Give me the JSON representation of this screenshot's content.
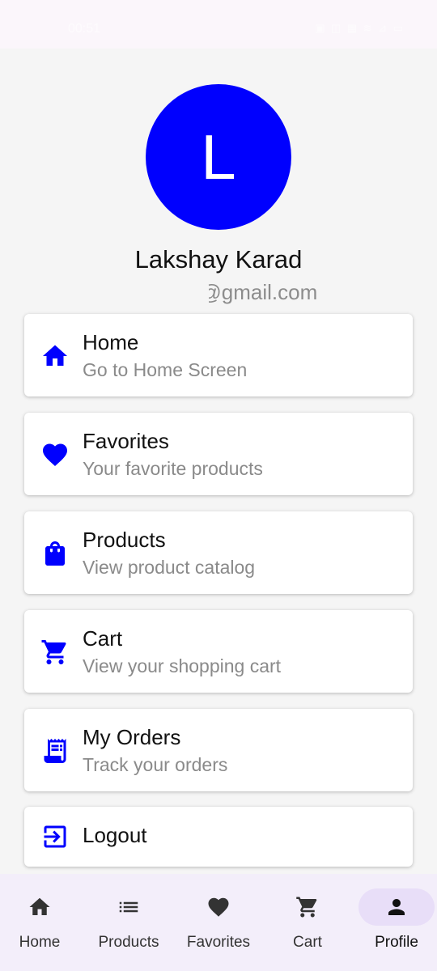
{
  "status_bar": {
    "time": "00:51",
    "icons": "▣ ◫ ▦ ≋ ⊿ ▭"
  },
  "profile": {
    "avatar_letter": "L",
    "name": "Lakshay Karad",
    "email": "rs@gmail.com"
  },
  "menu": [
    {
      "title": "Home",
      "subtitle": "Go to Home Screen",
      "icon": "home-icon"
    },
    {
      "title": "Favorites",
      "subtitle": "Your favorite products",
      "icon": "heart-icon"
    },
    {
      "title": "Products",
      "subtitle": "View product catalog",
      "icon": "shopping-bag-icon"
    },
    {
      "title": "Cart",
      "subtitle": "View your shopping cart",
      "icon": "cart-icon"
    },
    {
      "title": "My Orders",
      "subtitle": "Track your orders",
      "icon": "receipt-icon"
    },
    {
      "title": "Logout",
      "icon": "logout-icon"
    }
  ],
  "bottom_nav": {
    "items": [
      {
        "label": "Home",
        "icon": "home-icon"
      },
      {
        "label": "Products",
        "icon": "list-icon"
      },
      {
        "label": "Favorites",
        "icon": "heart-icon"
      },
      {
        "label": "Cart",
        "icon": "cart-icon"
      },
      {
        "label": "Profile",
        "icon": "person-icon"
      }
    ],
    "active": "Profile"
  },
  "colors": {
    "accent": "#0000fe",
    "background": "#f5f5f5",
    "nav_background": "#f3eefa",
    "nav_active_pill": "#e8def8"
  }
}
